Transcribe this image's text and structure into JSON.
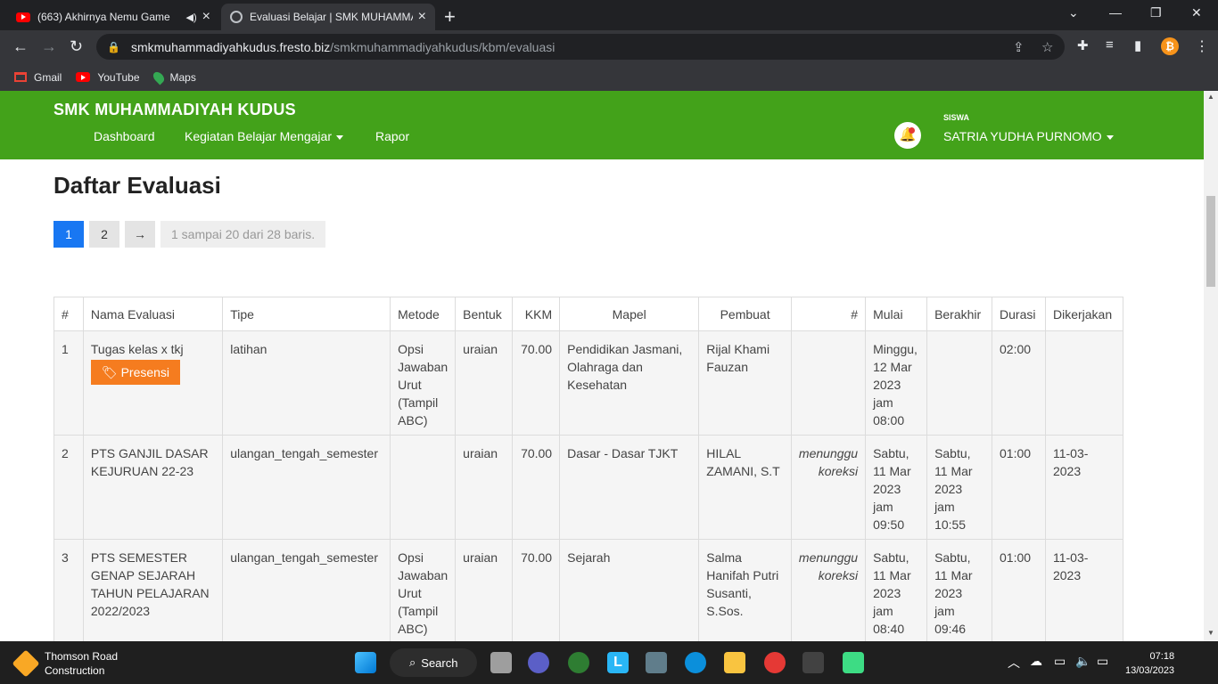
{
  "browser": {
    "tabs": [
      {
        "title": "(663) Akhirnya Nemu Game",
        "active": false
      },
      {
        "title": "Evaluasi Belajar | SMK MUHAMMADIYAH",
        "active": true
      }
    ],
    "url_host": "smkmuhammadiyahkudus.fresto.biz",
    "url_path": "/smkmuhammadiyahkudus/kbm/evaluasi",
    "bookmarks": [
      "Gmail",
      "YouTube",
      "Maps"
    ],
    "ext_badge": "₿"
  },
  "site": {
    "brand": "SMK MUHAMMADIYAH KUDUS",
    "menu": [
      "Dashboard",
      "Kegiatan Belajar Mengajar",
      "Rapor"
    ],
    "role": "SISWA",
    "user": "SATRIA YUDHA PURNOMO"
  },
  "page": {
    "title": "Daftar Evaluasi",
    "pages": [
      "1",
      "2",
      "→"
    ],
    "info": "1 sampai 20 dari 28 baris."
  },
  "table": {
    "headers": [
      "#",
      "Nama Evaluasi",
      "Tipe",
      "Metode",
      "Bentuk",
      "KKM",
      "Mapel",
      "Pembuat",
      "#",
      "Mulai",
      "Berakhir",
      "Durasi",
      "Dikerjakan"
    ],
    "presensi_label": "Presensi",
    "rows": [
      {
        "no": "1",
        "nama": "Tugas kelas x tkj",
        "tipe": "latihan",
        "metode": "Opsi Jawaban Urut (Tampil ABC)",
        "bentuk": "uraian",
        "kkm": "70.00",
        "mapel": "Pendidikan Jasmani, Olahraga dan Kesehatan",
        "pembuat": "Rijal Khami Fauzan",
        "status": "",
        "mulai": "Minggu, 12 Mar 2023 jam 08:00",
        "berakhir": "",
        "durasi": "02:00",
        "dikerjakan": ""
      },
      {
        "no": "2",
        "nama": "PTS GANJIL DASAR KEJURUAN 22-23",
        "tipe": "ulangan_tengah_semester",
        "metode": "",
        "bentuk": "uraian",
        "kkm": "70.00",
        "mapel": "Dasar - Dasar TJKT",
        "pembuat": "HILAL ZAMANI, S.T",
        "status": "menunggu koreksi",
        "mulai": "Sabtu, 11 Mar 2023 jam 09:50",
        "berakhir": "Sabtu, 11 Mar 2023 jam 10:55",
        "durasi": "01:00",
        "dikerjakan": "11-03-2023"
      },
      {
        "no": "3",
        "nama": "PTS SEMESTER GENAP SEJARAH TAHUN PELAJARAN 2022/2023",
        "tipe": "ulangan_tengah_semester",
        "metode": "Opsi Jawaban Urut (Tampil ABC)",
        "bentuk": "uraian",
        "kkm": "70.00",
        "mapel": "Sejarah",
        "pembuat": "Salma Hanifah Putri Susanti, S.Sos.",
        "status": "menunggu koreksi",
        "mulai": "Sabtu, 11 Mar 2023 jam 08:40",
        "berakhir": "Sabtu, 11 Mar 2023 jam 09:46",
        "durasi": "01:00",
        "dikerjakan": "11-03-2023"
      }
    ]
  },
  "taskbar": {
    "weather_title": "Thomson Road",
    "weather_sub": "Construction",
    "search": "Search",
    "time": "07:18",
    "date": "13/03/2023"
  },
  "colors": {
    "navbar": "#43a21a",
    "accent": "#1877f2",
    "presensi": "#f57c1f"
  }
}
